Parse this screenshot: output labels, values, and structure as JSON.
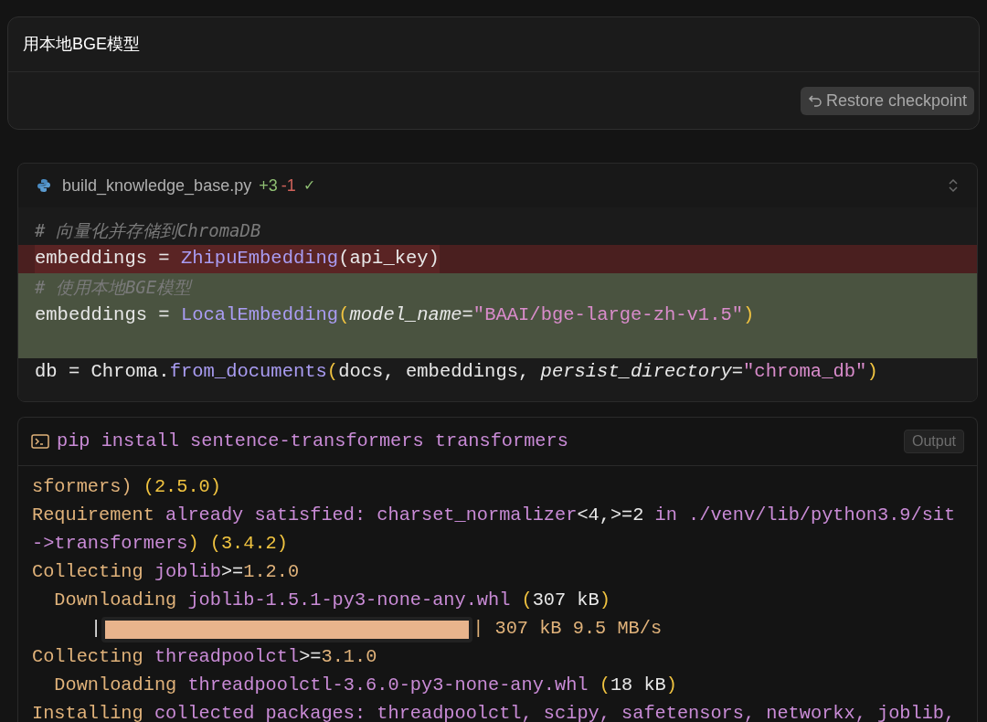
{
  "message": {
    "text": "用本地BGE模型",
    "restore_button": "Restore checkpoint"
  },
  "diff": {
    "file": "build_knowledge_base.py",
    "added": "+3",
    "removed": "-1",
    "status_mark": "✓",
    "lines": [
      {
        "kind": "context",
        "tokens": [
          {
            "kind": "comment",
            "text": "# 向量化并存储到ChromaDB"
          }
        ]
      },
      {
        "kind": "removed",
        "tokens": [
          {
            "kind": "plain",
            "text": "embeddings = "
          },
          {
            "kind": "func",
            "text": "ZhipuEmbedding"
          },
          {
            "kind": "plain",
            "text": "(api_key)"
          }
        ]
      },
      {
        "kind": "added",
        "tokens": [
          {
            "kind": "comment",
            "text": "# 使用本地BGE模型"
          }
        ]
      },
      {
        "kind": "added",
        "tokens": [
          {
            "kind": "plain",
            "text": "embeddings = "
          },
          {
            "kind": "func",
            "text": "LocalEmbedding"
          },
          {
            "kind": "paren",
            "text": "("
          },
          {
            "kind": "param",
            "text": "model_name"
          },
          {
            "kind": "plain",
            "text": "="
          },
          {
            "kind": "string",
            "text": "\"BAAI/bge-large-zh-v1.5\""
          },
          {
            "kind": "paren",
            "text": ")"
          }
        ]
      },
      {
        "kind": "added"
      },
      {
        "kind": "context",
        "tokens": [
          {
            "kind": "plain",
            "text": "db = Chroma."
          },
          {
            "kind": "func",
            "text": "from_documents"
          },
          {
            "kind": "paren",
            "text": "("
          },
          {
            "kind": "plain",
            "text": "docs, embeddings, "
          },
          {
            "kind": "param",
            "text": "persist_directory"
          },
          {
            "kind": "plain",
            "text": "="
          },
          {
            "kind": "string",
            "text": "\"chroma_db\""
          },
          {
            "kind": "paren",
            "text": ")"
          }
        ]
      }
    ]
  },
  "terminal": {
    "command": "pip install sentence-transformers transformers",
    "output_button": "Output",
    "lines": [
      {
        "kind": "text",
        "tokens": [
          {
            "kind": "keyword",
            "text": "sformers)"
          },
          {
            "kind": "num",
            "text": " (2.5.0)"
          }
        ]
      },
      {
        "kind": "text",
        "tokens": [
          {
            "kind": "keyword",
            "text": "Requirement "
          },
          {
            "kind": "name",
            "text": "already satisfied: charset_normalizer"
          },
          {
            "kind": "plain",
            "text": "<4,>=2 "
          },
          {
            "kind": "name",
            "text": "in ./venv/lib/python3.9/sit"
          }
        ]
      },
      {
        "kind": "text",
        "tokens": [
          {
            "kind": "name",
            "text": "->transformers"
          },
          {
            "kind": "num",
            "text": ") (3.4.2)"
          }
        ]
      },
      {
        "kind": "text",
        "tokens": [
          {
            "kind": "keyword",
            "text": "Collecting "
          },
          {
            "kind": "name",
            "text": "joblib"
          },
          {
            "kind": "plain",
            "text": ">="
          },
          {
            "kind": "keyword",
            "text": "1.2.0"
          }
        ]
      },
      {
        "kind": "text",
        "tokens": [
          {
            "kind": "keyword",
            "text": "  Downloading "
          },
          {
            "kind": "name",
            "text": "joblib-1.5.1-py3-none-any.whl "
          },
          {
            "kind": "num",
            "text": "("
          },
          {
            "kind": "plain",
            "text": "307 kB"
          },
          {
            "kind": "num",
            "text": ")"
          }
        ]
      },
      {
        "kind": "progress",
        "edge": "|",
        "level": 1,
        "tail": "| 307 kB 9.5 MB/s"
      },
      {
        "kind": "text",
        "tokens": [
          {
            "kind": "keyword",
            "text": "Collecting "
          },
          {
            "kind": "name",
            "text": "threadpoolctl"
          },
          {
            "kind": "plain",
            "text": ">="
          },
          {
            "kind": "keyword",
            "text": "3.1.0"
          }
        ]
      },
      {
        "kind": "text",
        "tokens": [
          {
            "kind": "keyword",
            "text": "  Downloading "
          },
          {
            "kind": "name",
            "text": "threadpoolctl-3.6.0-py3-none-any.whl "
          },
          {
            "kind": "num",
            "text": "("
          },
          {
            "kind": "plain",
            "text": "18 kB"
          },
          {
            "kind": "num",
            "text": ")"
          }
        ]
      },
      {
        "kind": "text",
        "tokens": [
          {
            "kind": "keyword",
            "text": "Installing "
          },
          {
            "kind": "name",
            "text": "collected packages: threadpoolctl, scipy, safetensors, networkx, joblib,"
          }
        ]
      }
    ]
  }
}
